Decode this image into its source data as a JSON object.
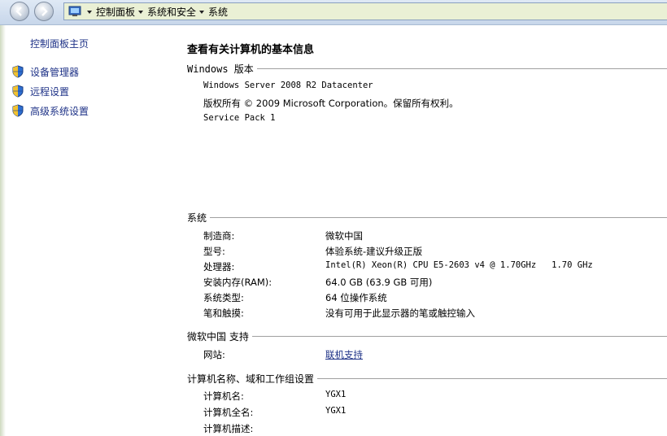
{
  "address_bar": {
    "crumbs": [
      "控制面板",
      "系统和安全",
      "系统"
    ]
  },
  "sidebar": {
    "home": "控制面板主页",
    "items": [
      {
        "label": "设备管理器"
      },
      {
        "label": "远程设置"
      },
      {
        "label": "高级系统设置"
      }
    ]
  },
  "main": {
    "title": "查看有关计算机的基本信息",
    "windows_edition": {
      "header": "Windows 版本",
      "name": "Windows Server 2008 R2 Datacenter",
      "copyright": "版权所有 © 2009 Microsoft Corporation。保留所有权利。",
      "service_pack": "Service Pack 1"
    },
    "system": {
      "header": "系统",
      "rows": [
        {
          "key": "制造商:",
          "value": "微软中国"
        },
        {
          "key": "型号:",
          "value": "体验系统-建议升级正版"
        },
        {
          "key": "处理器:",
          "value": "Intel(R) Xeon(R) CPU E5-2603 v4 @ 1.70GHz   1.70 GHz"
        },
        {
          "key": "安装内存(RAM):",
          "value": "64.0 GB (63.9 GB 可用)"
        },
        {
          "key": "系统类型:",
          "value": "64 位操作系统"
        },
        {
          "key": "笔和触摸:",
          "value": "没有可用于此显示器的笔或触控输入"
        }
      ]
    },
    "support": {
      "header": "微软中国 支持",
      "website_key": "网站:",
      "website_value": "联机支持"
    },
    "computer_name": {
      "header": "计算机名称、域和工作组设置",
      "rows": [
        {
          "key": "计算机名:",
          "value": "YGX1"
        },
        {
          "key": "计算机全名:",
          "value": "YGX1"
        },
        {
          "key": "计算机描述:",
          "value": ""
        }
      ]
    }
  }
}
